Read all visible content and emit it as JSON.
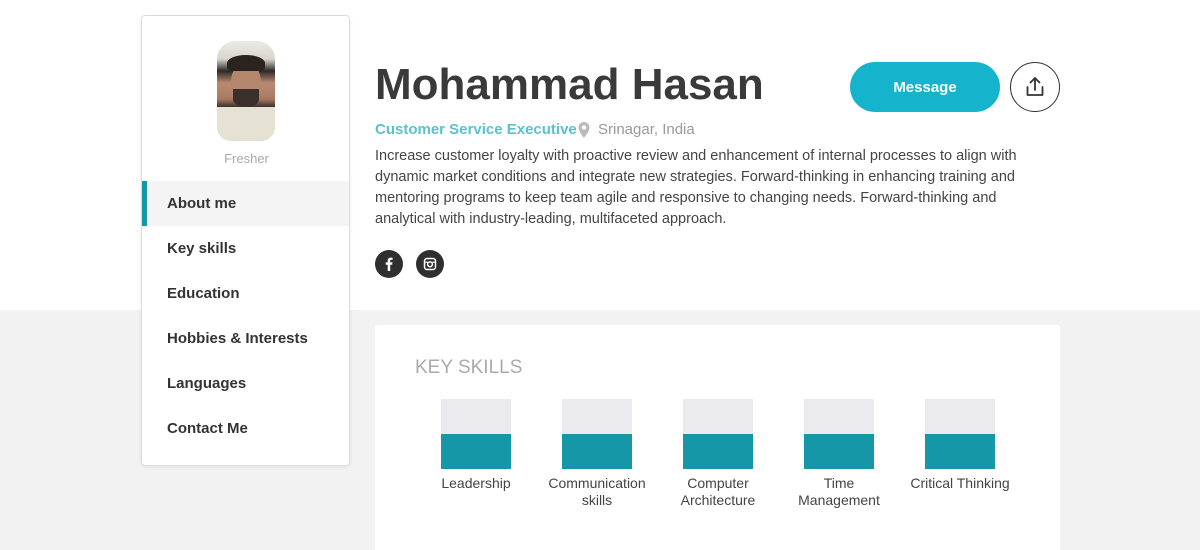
{
  "sidebar": {
    "status": "Fresher",
    "items": [
      {
        "label": "About me",
        "active": true
      },
      {
        "label": "Key skills"
      },
      {
        "label": "Education"
      },
      {
        "label": "Hobbies & Interests"
      },
      {
        "label": "Languages"
      },
      {
        "label": "Contact Me"
      }
    ]
  },
  "profile": {
    "name": "Mohammad Hasan",
    "role": "Customer Service Executive",
    "location": "Srinagar, India",
    "bio": "Increase customer loyalty with proactive review and enhancement of internal processes to align with dynamic market conditions and integrate new strategies. Forward-thinking in enhancing training and mentoring programs to keep team agile and responsive to changing needs. Forward-thinking and analytical with industry-leading, multifaceted approach."
  },
  "actions": {
    "message_label": "Message",
    "share_icon": "share-upload-icon"
  },
  "socials": [
    "facebook-icon",
    "instagram-icon"
  ],
  "skills": {
    "title": "KEY SKILLS",
    "items": [
      {
        "label": "Leadership",
        "level": 0.5
      },
      {
        "label": "Communication skills",
        "level": 0.5
      },
      {
        "label": "Computer Architecture",
        "level": 0.5
      },
      {
        "label": "Time Management",
        "level": 0.5
      },
      {
        "label": "Critical Thinking",
        "level": 0.5
      }
    ]
  },
  "colors": {
    "accent": "#1597a8",
    "button": "#16b4cc",
    "role_text": "#5bc0cf"
  }
}
